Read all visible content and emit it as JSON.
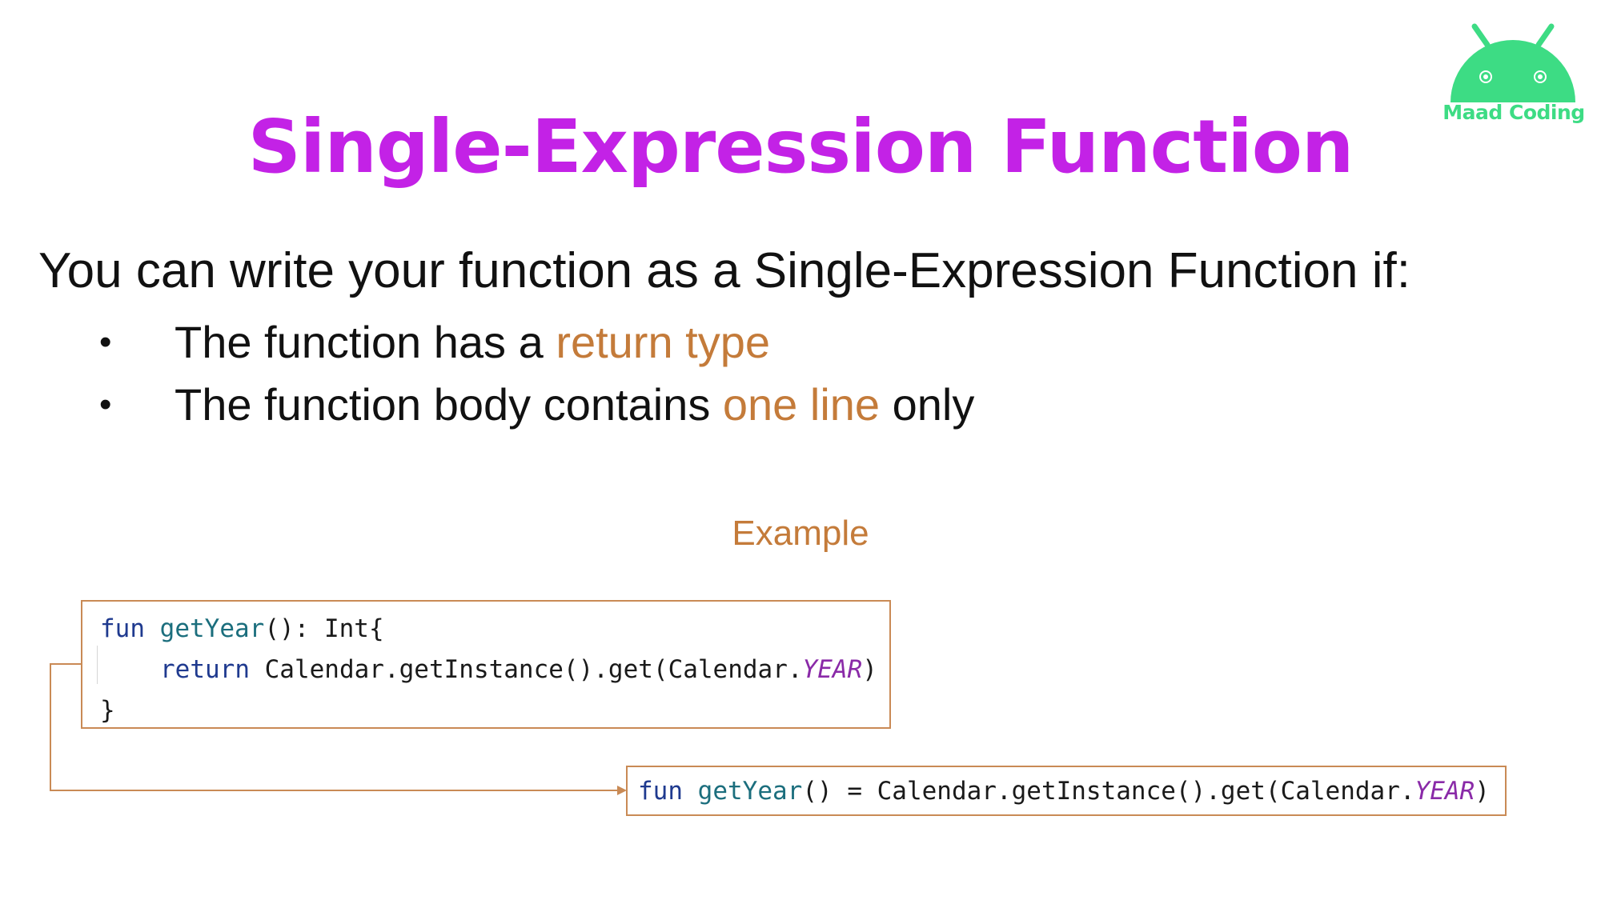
{
  "title": "Single-Expression Function",
  "intro": "You can write your function as a Single-Expression Function if:",
  "bullets": [
    {
      "dot": "•",
      "before": "The function has a ",
      "highlight": "return type",
      "after": ""
    },
    {
      "dot": "•",
      "before": "The function body contains ",
      "highlight": "one line",
      "after": " only"
    }
  ],
  "example_label": "Example",
  "code_block": {
    "line1": {
      "kw": "fun",
      "fn": "getYear",
      "rest": "(): Int{"
    },
    "line2": {
      "kw": "return",
      "rest": " Calendar.getInstance().get(Calendar.",
      "prop": "YEAR",
      "end": ")"
    },
    "line3": "}"
  },
  "code_single": {
    "kw": "fun",
    "fn": "getYear",
    "rest": "() = Calendar.getInstance().get(Calendar.",
    "prop": "YEAR",
    "end": ")"
  },
  "logo": {
    "text": "Maad Coding",
    "icon": "android-robot-icon",
    "color": "#3ddc84"
  },
  "colors": {
    "title": "#c322e6",
    "accent": "#c47b3a",
    "keyword": "#1f3a8f",
    "function": "#1b6e7d",
    "constant": "#8a2aa8"
  }
}
